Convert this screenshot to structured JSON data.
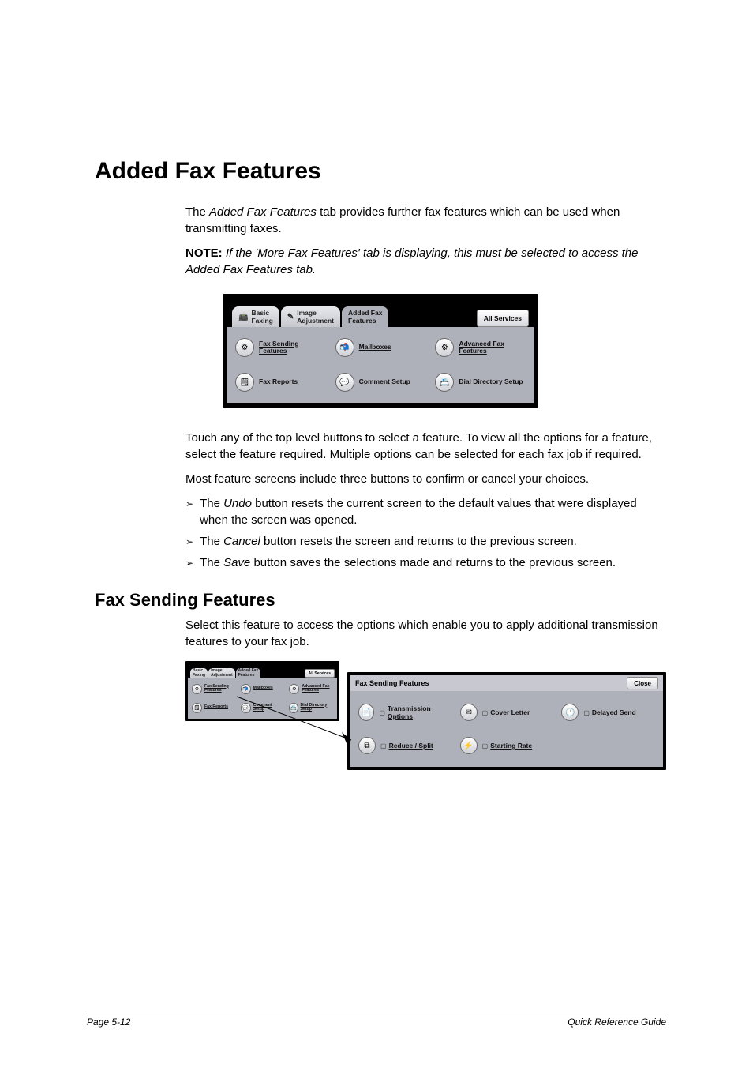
{
  "heading": "Added Fax Features",
  "intro_before_italic": "The ",
  "intro_italic": "Added Fax Features",
  "intro_after_italic": " tab provides further fax features which can be used when transmitting faxes.",
  "note_label": "NOTE:",
  "note_text": " If the 'More Fax Features' tab is displaying, this must be selected to access the Added Fax Features tab.",
  "touch_para": "Touch any of the top level buttons to select a feature. To view all the options for a feature, select the feature required. Multiple options can be selected for each fax job if required.",
  "most_para": "Most feature screens include three buttons to confirm or cancel your choices.",
  "bullets": [
    {
      "pre": "The ",
      "em": "Undo",
      "post": " button resets the current screen to the default values that were displayed when the screen was opened."
    },
    {
      "pre": "The ",
      "em": "Cancel",
      "post": " button resets the screen and returns to the previous screen."
    },
    {
      "pre": "The ",
      "em": "Save",
      "post": " button saves the selections made and returns to the previous screen."
    }
  ],
  "h2_fsf": "Fax Sending Features",
  "fsf_para": "Select this feature to access the options which enable you to apply additional transmission features to your fax job.",
  "ui_top": {
    "tab_basic": "Basic\nFaxing",
    "tab_image": "Image\nAdjustment",
    "tab_active": "Added Fax\nFeatures",
    "all_services": "All Services",
    "features": [
      "Fax Sending\nFeatures",
      "Mailboxes",
      "Advanced Fax\nFeatures",
      "Fax Reports",
      "Comment Setup",
      "Dial Directory Setup"
    ]
  },
  "ui_mini": {
    "tab_basic": "Basic\nFaxing",
    "tab_image": "Image\nAdjustment",
    "tab_active": "Added Fax\nFeatures",
    "all_services": "All Services",
    "features": [
      "Fax Sending\nFeatures",
      "Mailboxes",
      "Advanced Fax\nFeatures",
      "Fax Reports",
      "Comment Setup",
      "Dial Directory Setup"
    ]
  },
  "ui_fsf": {
    "title": "Fax Sending Features",
    "close": "Close",
    "options": [
      "Transmission Options",
      "Cover Letter",
      "Delayed Send",
      "Reduce / Split",
      "Starting Rate"
    ]
  },
  "footer_left": "Page 5-12",
  "footer_right": "Quick Reference Guide"
}
